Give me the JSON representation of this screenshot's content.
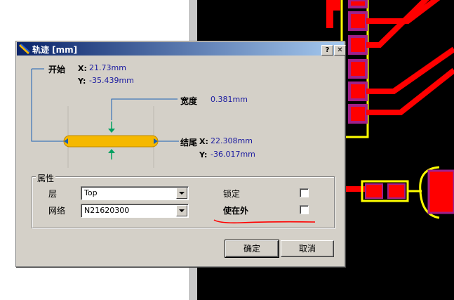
{
  "dialog": {
    "title": "轨迹 [mm]",
    "help_label": "?",
    "close_label": "✕",
    "start": {
      "label": "开始",
      "x_axis": "X:",
      "x_value": "21.73mm",
      "y_axis": "Y:",
      "y_value": "-35.439mm"
    },
    "width": {
      "label": "宽度",
      "value": "0.381mm"
    },
    "end": {
      "label": "结尾",
      "x_axis": "X:",
      "x_value": "22.308mm",
      "y_axis": "Y:",
      "y_value": "-36.017mm"
    },
    "properties": {
      "title": "属性",
      "layer_label": "层",
      "layer_value": "Top",
      "net_label": "网络",
      "net_value": "N21620300",
      "locked_label": "锁定",
      "keepout_label": "使在外"
    },
    "ok_label": "确定",
    "cancel_label": "取消"
  },
  "colors": {
    "trace_fill": "#f5b800",
    "preview_line": "#1a5fb4",
    "width_arrow": "#00a060",
    "annotation_red": "#ff0000",
    "pcb_pad_red": "#ff0000",
    "pcb_pad_border": "#a0208a",
    "pcb_yellow": "#ffff00"
  },
  "icons": [
    "trace-tool-icon",
    "help-icon",
    "close-icon"
  ]
}
